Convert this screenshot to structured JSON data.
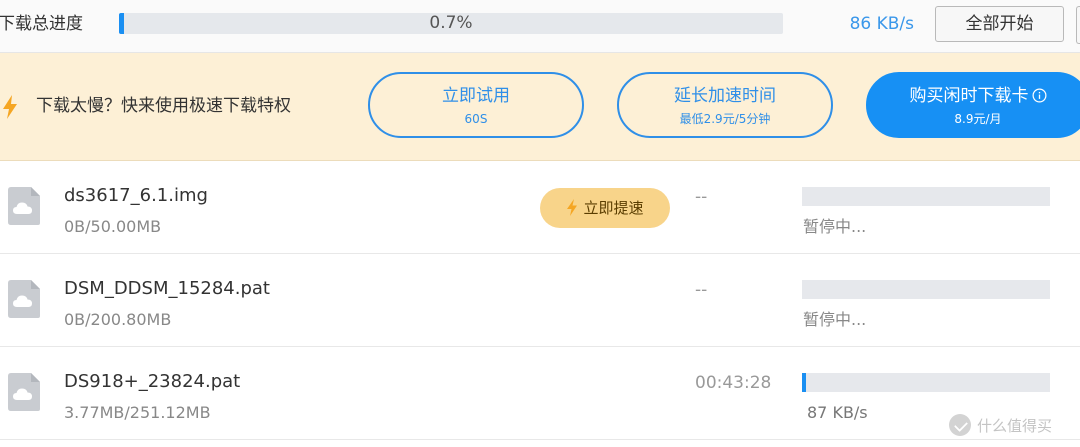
{
  "top": {
    "total_label": "下载总进度",
    "total_percent_text": "0.7%",
    "total_progress": 0.007,
    "total_speed": "86 KB/s",
    "start_all_label": "全部开始"
  },
  "banner": {
    "promo_text": "下载太慢？快来使用极速下载特权",
    "trial": {
      "title": "立即试用",
      "subtitle": "60S"
    },
    "extend": {
      "title": "延长加速时间",
      "subtitle": "最低2.9元/5分钟"
    },
    "buy": {
      "title": "购买闲时下载卡",
      "subtitle": "8.9元/月"
    }
  },
  "rows": [
    {
      "name": "ds3617_6.1.img",
      "size": "0B/50.00MB",
      "boost_label": "立即提速",
      "time_left": "--",
      "progress": 0,
      "status": "暂停中..."
    },
    {
      "name": "DSM_DDSM_15284.pat",
      "size": "0B/200.80MB",
      "time_left": "--",
      "progress": 0,
      "status": "暂停中..."
    },
    {
      "name": "DS918+_23824.pat",
      "size": "3.77MB/251.12MB",
      "time_left": "00:43:28",
      "progress": 0.015,
      "status": "87 KB/s"
    }
  ],
  "watermark": {
    "text": "什么值得买"
  },
  "colors": {
    "accent": "#1a8ff2",
    "banner_bg": "#fdf0d6",
    "boost_bg": "#f8d48a",
    "speed_text": "#3a97ea"
  },
  "icons": {
    "banner": "lightning-icon",
    "file": "cloud-file-icon",
    "boost": "lightning-icon",
    "buy_info": "info-circle-icon"
  }
}
